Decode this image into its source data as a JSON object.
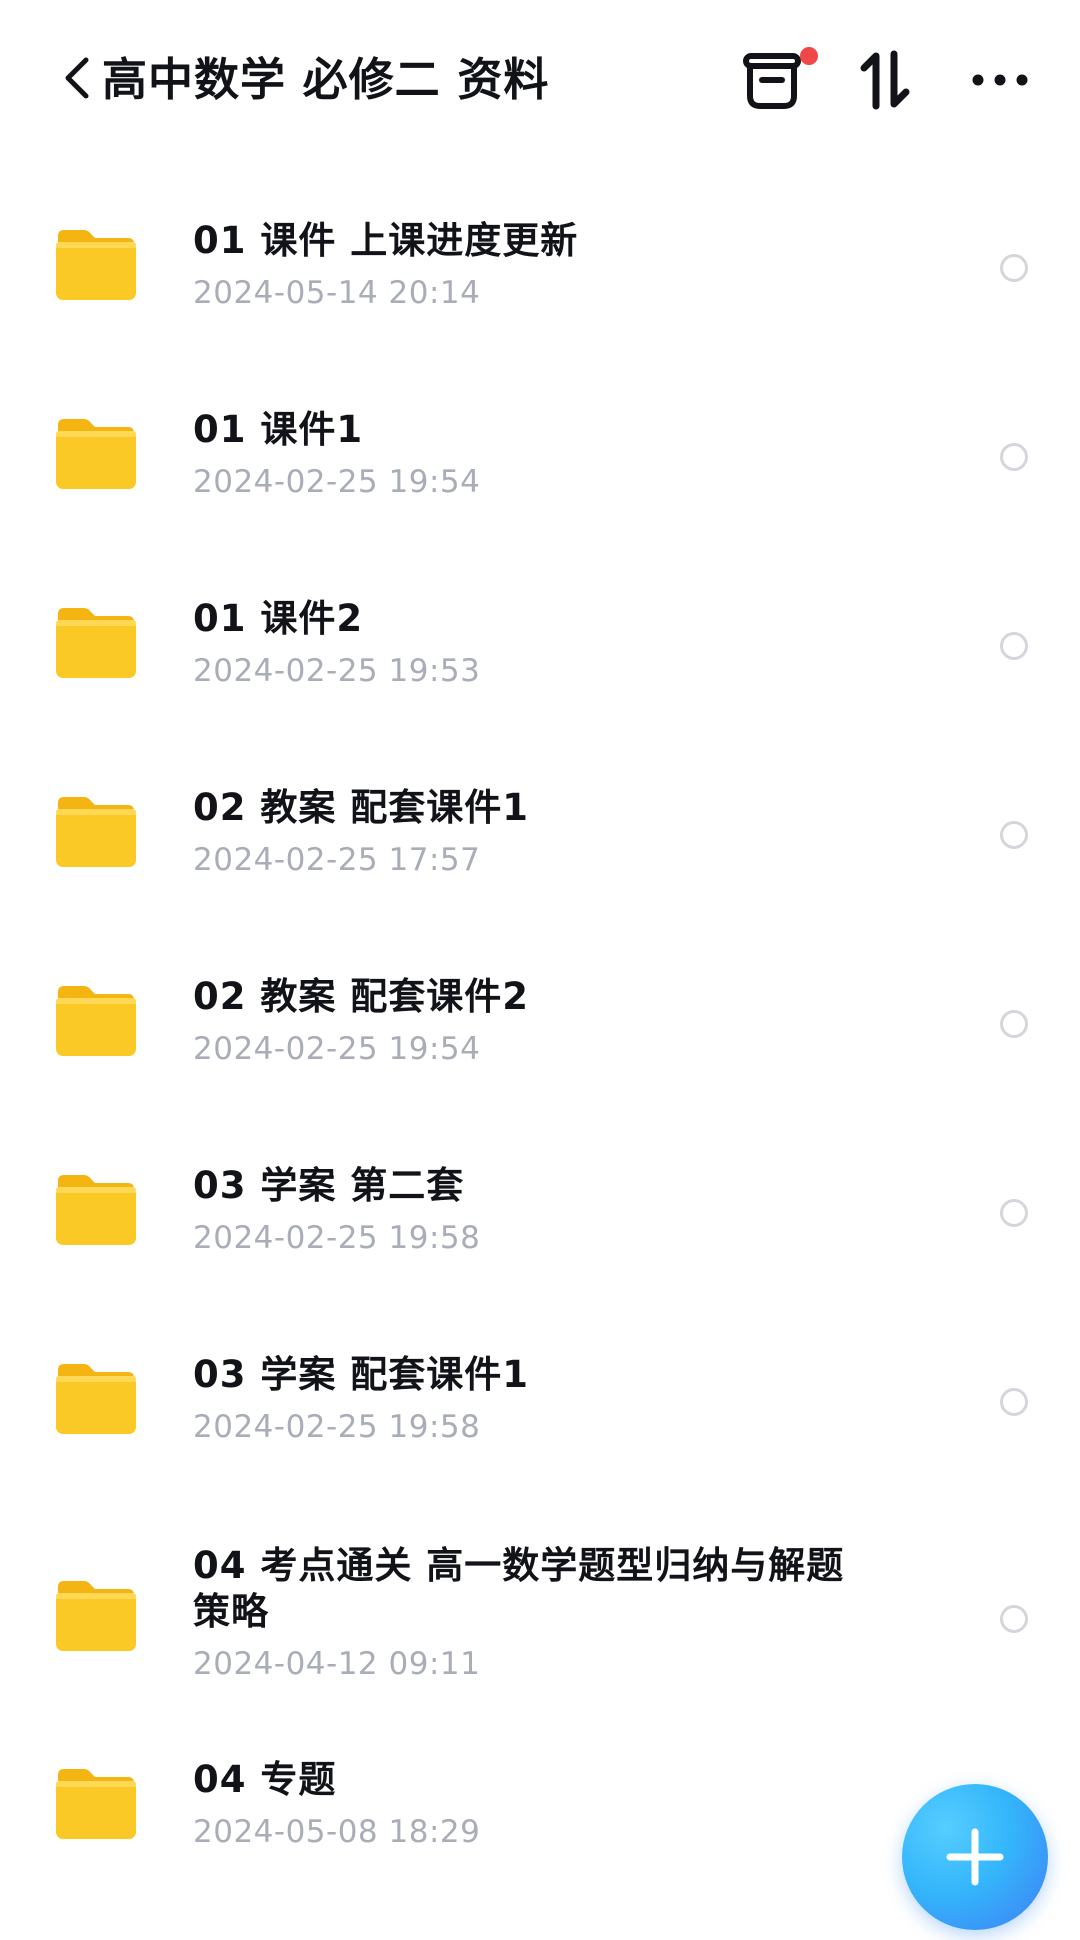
{
  "header": {
    "title": "高中数学 必修二 资料",
    "back_icon": "chevron-left-icon",
    "actions": [
      "trash-icon",
      "sort-icon",
      "more-icon"
    ],
    "notify_dot_color": "#f04848"
  },
  "files": [
    {
      "name": "01 课件 上课进度更新",
      "date": "2024-05-14 20:14"
    },
    {
      "name": "01 课件1",
      "date": "2024-02-25 19:54"
    },
    {
      "name": "01 课件2",
      "date": "2024-02-25 19:53"
    },
    {
      "name": "02 教案 配套课件1",
      "date": "2024-02-25 17:57"
    },
    {
      "name": "02 教案 配套课件2",
      "date": "2024-02-25 19:54"
    },
    {
      "name": "03 学案 第二套",
      "date": "2024-02-25 19:58"
    },
    {
      "name": "03 学案 配套课件1",
      "date": "2024-02-25 19:58"
    },
    {
      "name": "04 考点通关 高一数学题型归纳与解题策略",
      "date": "2024-04-12 09:11"
    },
    {
      "name": "04 专题",
      "date": "2024-05-08 18:29"
    }
  ],
  "fab": {
    "icon": "plus-icon",
    "color": "#34b6fb"
  },
  "colors": {
    "folder": "#fbc926",
    "text_primary": "#111318",
    "text_secondary": "#a9adb8"
  }
}
